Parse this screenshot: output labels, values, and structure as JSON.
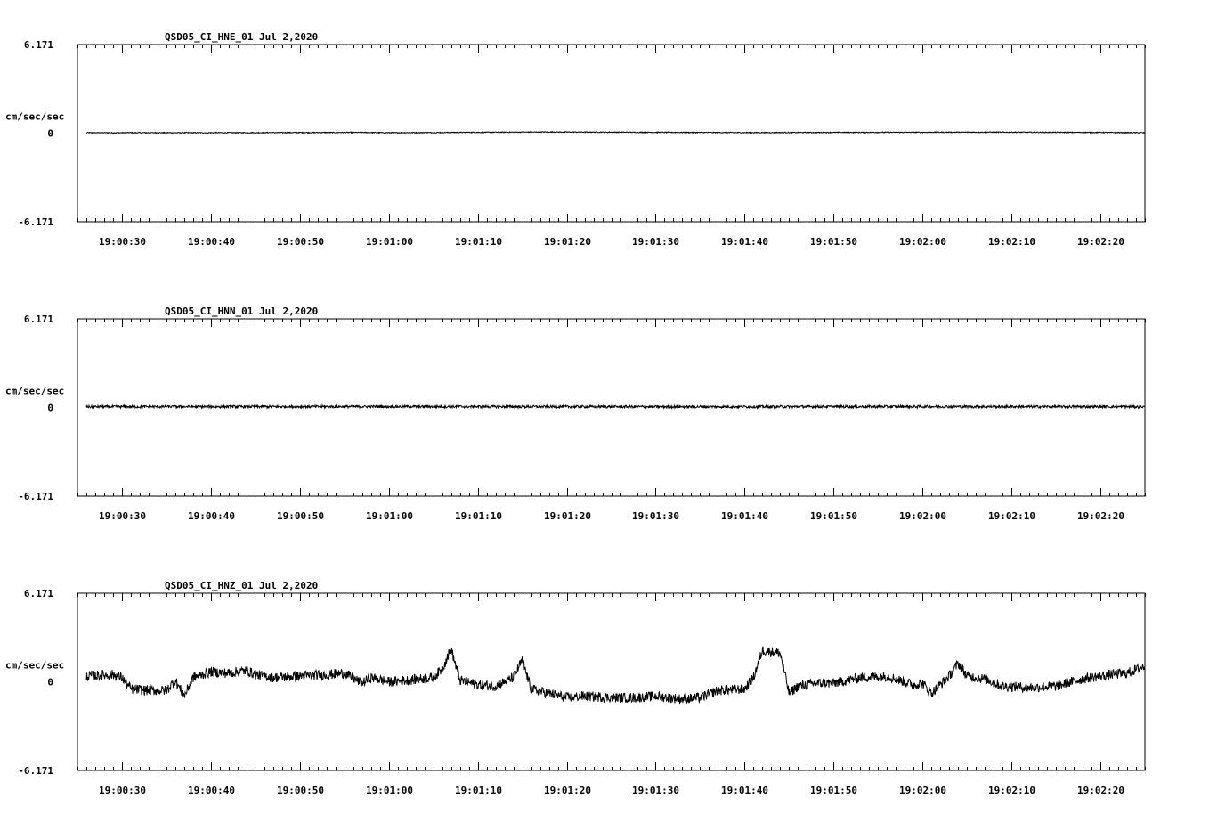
{
  "chart_data": [
    {
      "type": "line",
      "title": "QSD05_CI_HNE_01  Jul 2,2020",
      "ylabel": "cm/sec/sec",
      "yticks": [
        "6.171",
        "0",
        "-6.171"
      ],
      "ylim": [
        -6.171,
        6.171
      ],
      "xticks": [
        "19:00:30",
        "19:00:40",
        "19:00:50",
        "19:01:00",
        "19:01:10",
        "19:01:20",
        "19:01:30",
        "19:01:40",
        "19:01:50",
        "19:02:00",
        "19:02:10",
        "19:02:20"
      ],
      "xlim": [
        "19:00:25",
        "19:02:25"
      ],
      "grid": false,
      "series": [
        {
          "x": [
            "19:00:26",
            "19:00:40",
            "19:00:57",
            "19:01:00",
            "19:01:18",
            "19:01:40",
            "19:02:07",
            "19:02:20",
            "19:02:25"
          ],
          "values": [
            0.03,
            0.03,
            0.05,
            0.03,
            0.08,
            0.04,
            0.07,
            0.05,
            0.03
          ],
          "noise": 0.03
        }
      ]
    },
    {
      "type": "line",
      "title": "QSD05_CI_HNN_01  Jul 2,2020",
      "ylabel": "cm/sec/sec",
      "yticks": [
        "6.171",
        "0",
        "-6.171"
      ],
      "ylim": [
        -6.171,
        6.171
      ],
      "xticks": [
        "19:00:30",
        "19:00:40",
        "19:00:50",
        "19:01:00",
        "19:01:10",
        "19:01:20",
        "19:01:30",
        "19:01:40",
        "19:01:50",
        "19:02:00",
        "19:02:10",
        "19:02:20"
      ],
      "xlim": [
        "19:00:25",
        "19:02:25"
      ],
      "grid": false,
      "series": [
        {
          "x": [
            "19:00:26",
            "19:01:00",
            "19:01:30",
            "19:02:00",
            "19:02:25"
          ],
          "values": [
            0.05,
            0.06,
            0.05,
            0.06,
            0.05
          ],
          "noise": 0.09
        }
      ]
    },
    {
      "type": "line",
      "title": "QSD05_CI_HNZ_01  Jul 2,2020",
      "ylabel": "cm/sec/sec",
      "yticks": [
        "6.171",
        "0",
        "-6.171"
      ],
      "ylim": [
        -6.171,
        6.171
      ],
      "xticks": [
        "19:00:30",
        "19:00:40",
        "19:00:50",
        "19:01:00",
        "19:01:10",
        "19:01:20",
        "19:01:30",
        "19:01:40",
        "19:01:50",
        "19:02:00",
        "19:02:10",
        "19:02:20"
      ],
      "xlim": [
        "19:00:25",
        "19:02:25"
      ],
      "grid": false,
      "series": [
        {
          "x": [
            "19:00:26",
            "19:00:29",
            "19:00:30",
            "19:00:31",
            "19:00:33",
            "19:00:35",
            "19:00:36",
            "19:00:37",
            "19:00:38",
            "19:00:40",
            "19:00:42",
            "19:00:44",
            "19:00:45",
            "19:00:47",
            "19:00:50",
            "19:00:53",
            "19:00:55",
            "19:00:57",
            "19:00:58",
            "19:01:00",
            "19:01:02",
            "19:01:05",
            "19:01:06",
            "19:01:07",
            "19:01:08",
            "19:01:10",
            "19:01:12",
            "19:01:14",
            "19:01:15",
            "19:01:16",
            "19:01:18",
            "19:01:20",
            "19:01:22",
            "19:01:25",
            "19:01:28",
            "19:01:30",
            "19:01:33",
            "19:01:35",
            "19:01:37",
            "19:01:40",
            "19:01:41",
            "19:01:42",
            "19:01:44",
            "19:01:45",
            "19:01:46",
            "19:01:48",
            "19:01:50",
            "19:01:53",
            "19:01:56",
            "19:01:59",
            "19:02:00",
            "19:02:01",
            "19:02:03",
            "19:02:04",
            "19:02:05",
            "19:02:07",
            "19:02:09",
            "19:02:12",
            "19:02:15",
            "19:02:18",
            "19:02:21",
            "19:02:23",
            "19:02:25"
          ],
          "values": [
            0.4,
            0.5,
            0.3,
            -0.5,
            -0.6,
            -0.6,
            0.1,
            -1.0,
            0.3,
            0.7,
            0.6,
            0.8,
            0.5,
            0.3,
            0.4,
            0.5,
            0.6,
            -0.1,
            0.3,
            0.0,
            0.1,
            0.3,
            0.9,
            2.3,
            0.1,
            -0.2,
            -0.3,
            0.3,
            1.5,
            -0.5,
            -0.8,
            -1.1,
            -1.0,
            -1.1,
            -1.1,
            -1.0,
            -1.2,
            -1.1,
            -0.6,
            -0.5,
            0.3,
            2.2,
            2.0,
            -0.8,
            -0.3,
            -0.1,
            -0.1,
            0.3,
            0.4,
            -0.2,
            -0.1,
            -0.8,
            0.4,
            1.3,
            0.4,
            0.2,
            -0.3,
            -0.4,
            -0.3,
            0.2,
            0.5,
            0.6,
            1.1
          ],
          "noise": 0.35
        }
      ]
    }
  ]
}
